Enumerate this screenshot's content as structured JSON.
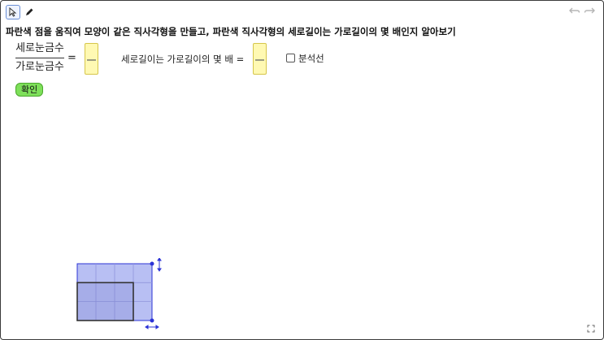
{
  "instruction": "파란색 점을 움직여 모양이 같은 직사각형을 만들고, 파란색 직사각형의 세로길이는 가로길이의 몇 배인지 알아보기",
  "fraction": {
    "numerator": "세로눈금수",
    "denominator": "가로눈금수",
    "equals": "="
  },
  "question2": "세로길이는 가로길이의 몇 배 =",
  "checkbox": {
    "label": "분석선",
    "checked": false
  },
  "confirm_label": "확인",
  "colors": {
    "grid_fill": "#b8bff3",
    "grid_border": "#2b33d6",
    "confirm_button": "#7ee05a",
    "input_box": "#fff9b3"
  },
  "icons": [
    "select-icon",
    "pen-icon",
    "undo-icon",
    "redo-icon",
    "fullscreen-icon",
    "vertical-arrow-icon",
    "horizontal-arrow-icon"
  ]
}
